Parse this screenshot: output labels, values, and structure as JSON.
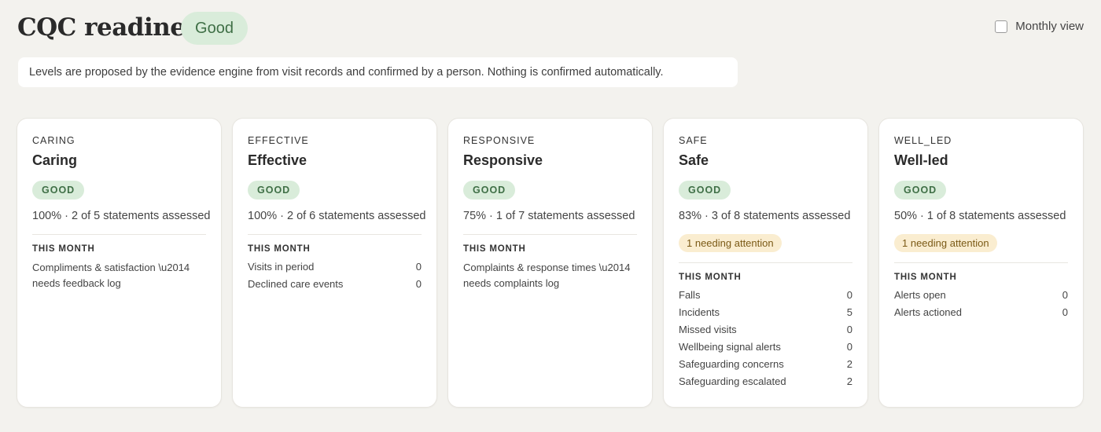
{
  "header": {
    "title": "CQC readiness",
    "overall_level": "Good",
    "monthly_view_label": "Monthly view",
    "monthly_view_checked": false
  },
  "notice": "Levels are proposed by the evidence engine from visit records and confirmed by a person. Nothing is confirmed automatically.",
  "colors": {
    "good_badge_bg": "#d9ecda",
    "good_badge_text": "#3f6f46",
    "attention_badge_bg": "#faedd0",
    "background": "#f3f2ee"
  },
  "cards": [
    {
      "key": "CARING",
      "name": "Caring",
      "level": "GOOD",
      "progress": "100% · 2 of 5 statements assessed",
      "section_label": "THIS MONTH",
      "note": "Compliments & satisfaction \\u2014 needs feedback log"
    },
    {
      "key": "EFFECTIVE",
      "name": "Effective",
      "level": "GOOD",
      "progress": "100% · 2 of 6 statements assessed",
      "section_label": "THIS MONTH",
      "metrics": [
        {
          "label": "Visits in period",
          "value": "0"
        },
        {
          "label": "Declined care events",
          "value": "0"
        }
      ]
    },
    {
      "key": "RESPONSIVE",
      "name": "Responsive",
      "level": "GOOD",
      "progress": "75% · 1 of 7 statements assessed",
      "section_label": "THIS MONTH",
      "note": "Complaints & response times \\u2014 needs complaints log"
    },
    {
      "key": "SAFE",
      "name": "Safe",
      "level": "GOOD",
      "progress": "83% · 3 of 8 statements assessed",
      "attention": "1 needing attention",
      "section_label": "THIS MONTH",
      "metrics": [
        {
          "label": "Falls",
          "value": "0"
        },
        {
          "label": "Incidents",
          "value": "5"
        },
        {
          "label": "Missed visits",
          "value": "0"
        },
        {
          "label": "Wellbeing signal alerts",
          "value": "0"
        },
        {
          "label": "Safeguarding concerns",
          "value": "2"
        },
        {
          "label": "Safeguarding escalated",
          "value": "2"
        }
      ]
    },
    {
      "key": "WELL_LED",
      "name": "Well-led",
      "level": "GOOD",
      "progress": "50% · 1 of 8 statements assessed",
      "attention": "1 needing attention",
      "section_label": "THIS MONTH",
      "metrics": [
        {
          "label": "Alerts open",
          "value": "0"
        },
        {
          "label": "Alerts actioned",
          "value": "0"
        }
      ]
    }
  ]
}
